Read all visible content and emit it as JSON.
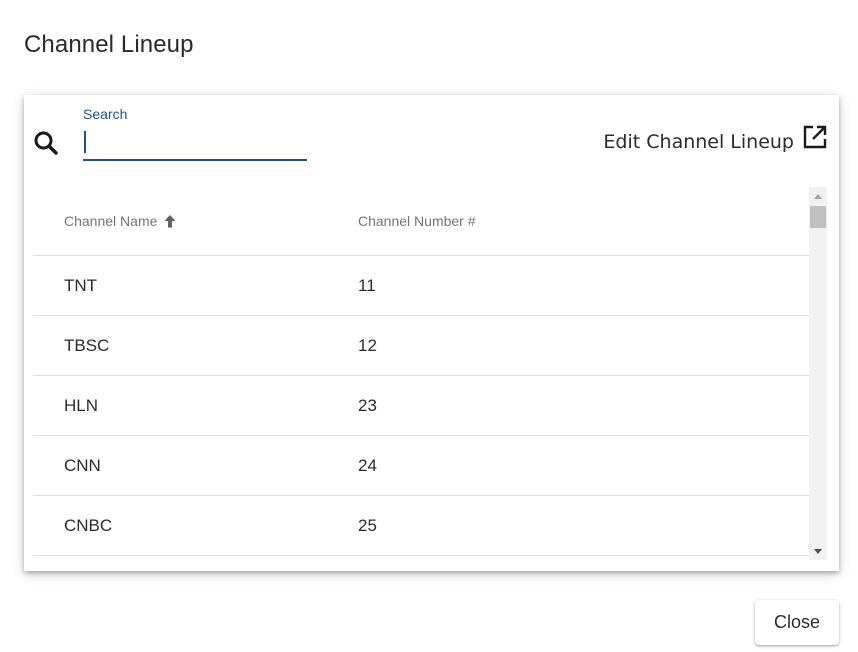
{
  "dialog": {
    "title": "Channel Lineup"
  },
  "search": {
    "label": "Search",
    "value": "",
    "placeholder": ""
  },
  "edit_link": {
    "label": "Edit Channel Lineup",
    "icon": "open-in-new-icon"
  },
  "table": {
    "columns": [
      {
        "label": "Channel Name",
        "sort": "ascending"
      },
      {
        "label": "Channel Number #"
      }
    ],
    "rows": [
      {
        "name": "TNT",
        "number": "11"
      },
      {
        "name": "TBSC",
        "number": "12"
      },
      {
        "name": "HLN",
        "number": "23"
      },
      {
        "name": "CNN",
        "number": "24"
      },
      {
        "name": "CNBC",
        "number": "25"
      },
      {
        "name": "",
        "number": ""
      }
    ]
  },
  "footer": {
    "close_label": "Close"
  },
  "colors": {
    "accent": "#1e4f9c",
    "text": "#2b2b2b",
    "muted": "#757575",
    "divider": "#e0e0e0"
  }
}
